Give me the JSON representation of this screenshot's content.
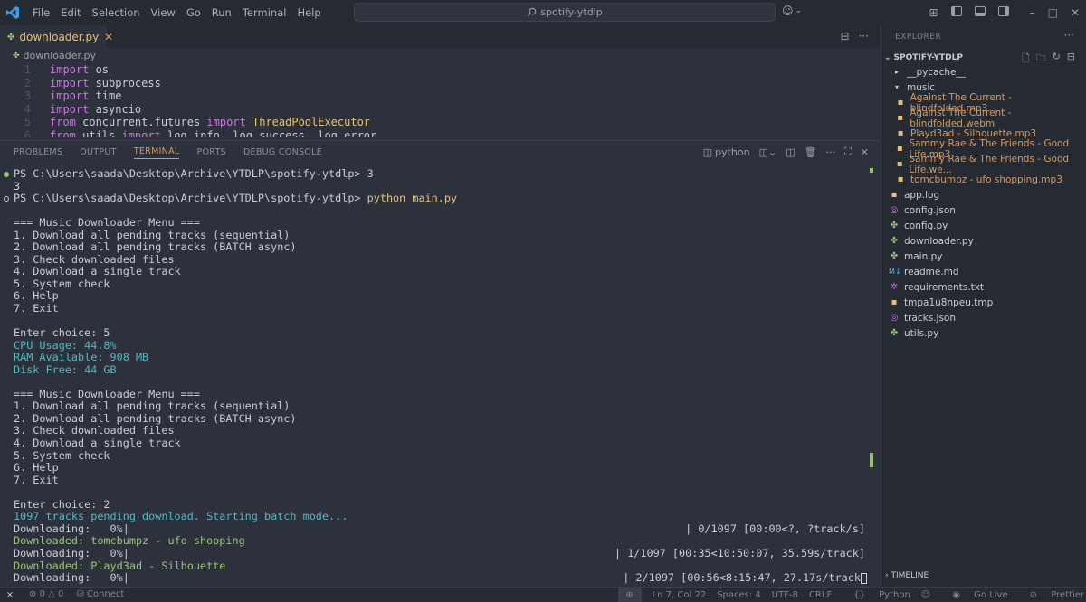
{
  "titlebar": {
    "menu": [
      "File",
      "Edit",
      "Selection",
      "View",
      "Go",
      "Run",
      "Terminal",
      "Help"
    ],
    "search_text": "spotify-ytdlp"
  },
  "editor": {
    "active_tab": "downloader.py",
    "breadcrumb": "downloader.py",
    "lines": [
      {
        "n": "1",
        "kw": "import",
        "rest": " os",
        "extra_kw": "",
        "extra": ""
      },
      {
        "n": "2",
        "kw": "import",
        "rest": " subprocess",
        "extra_kw": "",
        "extra": ""
      },
      {
        "n": "3",
        "kw": "import",
        "rest": " time",
        "extra_kw": "",
        "extra": ""
      },
      {
        "n": "4",
        "kw": "import",
        "rest": " asyncio",
        "extra_kw": "",
        "extra": ""
      },
      {
        "n": "5",
        "kw": "from",
        "rest": " concurrent.futures ",
        "extra_kw": "import",
        "extra": " ThreadPoolExecutor"
      },
      {
        "n": "6",
        "kw": "from",
        "rest": " utils ",
        "extra_kw": "import",
        "extra": " log_info, log_success, log_error"
      }
    ]
  },
  "panel": {
    "tabs": [
      "PROBLEMS",
      "OUTPUT",
      "TERMINAL",
      "PORTS",
      "DEBUG CONSOLE"
    ],
    "active_tab": "TERMINAL",
    "shell": "python"
  },
  "terminal": {
    "prompt": "PS C:\\Users\\saada\\Desktop\\Archive\\YTDLP\\spotify-ytdlp> ",
    "cmd1": "3",
    "echo1": "3",
    "cmd2": "python main.py",
    "menu_title": "=== Music Downloader Menu ===",
    "menu_items": [
      "1. Download all pending tracks (sequential)",
      "2. Download all pending tracks (BATCH async)",
      "3. Check downloaded files",
      "4. Download a single track",
      "5. System check",
      "6. Help",
      "7. Exit"
    ],
    "choice1": "Enter choice: 5",
    "sys_cpu": "CPU Usage: 44.8%",
    "sys_ram": "RAM Available: 908 MB",
    "sys_disk": "Disk Free: 44 GB",
    "choice2": "Enter choice: 2",
    "pending": "1097 tracks pending download. Starting batch mode...",
    "dl_label": "Downloading:   0%|",
    "progress1": "| 0/1097 [00:00<?, ?track/s]",
    "downloaded1": "Downloaded: tomcbumpz - ufo shopping",
    "progress2": "| 1/1097 [00:35<10:50:07, 35.59s/track]",
    "downloaded2": "Downloaded: Playd3ad - Silhouette",
    "progress3": "| 2/1097 [00:56<8:15:47, 27.17s/track"
  },
  "explorer": {
    "title": "EXPLORER",
    "project": "SPOTIFY-YTDLP",
    "tree": [
      {
        "label": "__pycache__",
        "type": "folder-closed"
      },
      {
        "label": "music",
        "type": "folder-open"
      },
      {
        "label": "Against The Current - blindfolded.mp3",
        "type": "file-audio"
      },
      {
        "label": "Against The Current - blindfolded.webm",
        "type": "file-audio"
      },
      {
        "label": "Playd3ad - Silhouette.mp3",
        "type": "file-audio"
      },
      {
        "label": "Sammy Rae & The Friends - Good Life.mp3",
        "type": "file-audio"
      },
      {
        "label": "Sammy Rae & The Friends - Good Life.we...",
        "type": "file-audio"
      },
      {
        "label": "tomcbumpz - ufo shopping.mp3",
        "type": "file-audio"
      },
      {
        "label": "app.log",
        "type": "file-log"
      },
      {
        "label": "config.json",
        "type": "file-json"
      },
      {
        "label": "config.py",
        "type": "file-python"
      },
      {
        "label": "downloader.py",
        "type": "file-python"
      },
      {
        "label": "main.py",
        "type": "file-python"
      },
      {
        "label": "readme.md",
        "type": "file-markdown"
      },
      {
        "label": "requirements.txt",
        "type": "file-settings"
      },
      {
        "label": "tmpa1u8npeu.tmp",
        "type": "file-temp"
      },
      {
        "label": "tracks.json",
        "type": "file-json"
      },
      {
        "label": "utils.py",
        "type": "file-python"
      }
    ],
    "timeline": "TIMELINE"
  },
  "statusbar": {
    "errors": "0",
    "warnings": "0",
    "connect": "Connect",
    "position": "Ln 7, Col 22",
    "spaces": "Spaces: 4",
    "encoding": "UTF-8",
    "eol": "CRLF",
    "language": "Python",
    "golive": "Go Live",
    "prettier": "Prettier"
  },
  "colors": {
    "accent": "#d19a66",
    "keyword": "#c678dd",
    "success": "#98c379",
    "info": "#56b6c2",
    "background": "#2d313b"
  }
}
